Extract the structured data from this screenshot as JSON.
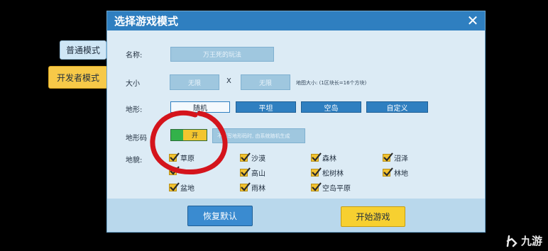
{
  "side_tabs": {
    "normal": "普通模式",
    "developer": "开发者模式"
  },
  "dialog": {
    "title": "选择游戏模式",
    "close_glyph": "✕",
    "name": {
      "label": "名称:",
      "value": "万王死的玩法"
    },
    "size": {
      "label": "大小",
      "width": "无限",
      "separator": "X",
      "height": "无限",
      "note": "地图大小: (1区块长=16个方块)"
    },
    "terrain": {
      "label": "地形:",
      "options": [
        "随机",
        "平坦",
        "空岛",
        "自定义"
      ],
      "selected": "随机"
    },
    "seed": {
      "label": "地形码",
      "toggle_label": "开",
      "input_text": "不填写地形码时, 由系统随机生成",
      "enabled": true
    },
    "biomes": {
      "label": "地貌:",
      "items": [
        {
          "name": "草原",
          "checked": true
        },
        {
          "name": "沙漠",
          "checked": true
        },
        {
          "name": "森林",
          "checked": true
        },
        {
          "name": "沼泽",
          "checked": true
        },
        {
          "name": "",
          "checked": true
        },
        {
          "name": "高山",
          "checked": true
        },
        {
          "name": "松树林",
          "checked": true
        },
        {
          "name": "林地",
          "checked": true
        },
        {
          "name": "盆地",
          "checked": true
        },
        {
          "name": "雨林",
          "checked": true
        },
        {
          "name": "空岛平原",
          "checked": true
        }
      ]
    },
    "buttons": {
      "reset": "恢复默认",
      "start": "开始游戏"
    }
  },
  "watermark": {
    "text": "九游"
  },
  "colors": {
    "title_bar": "#2f7fc0",
    "annotation_circle": "#d4141c",
    "accent_yellow": "#f7d030"
  }
}
